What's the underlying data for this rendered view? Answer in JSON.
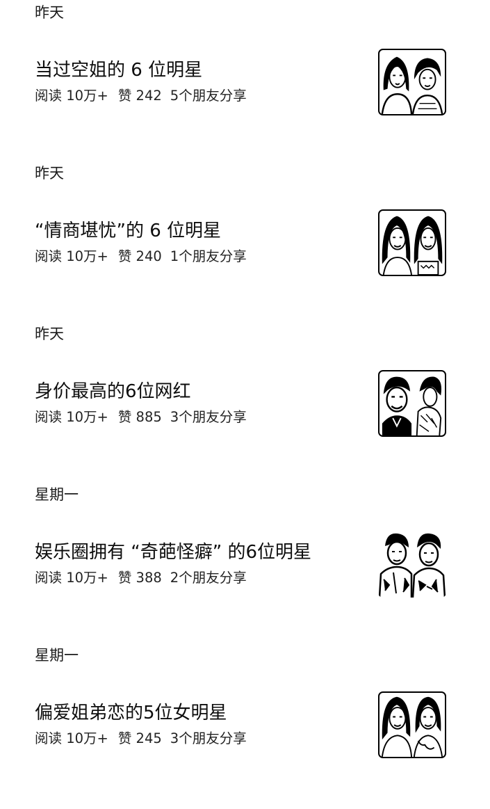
{
  "feed": [
    {
      "date": "昨天",
      "title": "当过空姐的 6 位明星",
      "reads": "阅读 10万+",
      "likes": "赞 242",
      "shares": "5个朋友分享",
      "thumbnail": "two-women-photo"
    },
    {
      "date": "昨天",
      "title": "“情商堪忧”的 6 位明星",
      "reads": "阅读 10万+",
      "likes": "赞 240",
      "shares": "1个朋友分享",
      "thumbnail": "two-women-photo"
    },
    {
      "date": "昨天",
      "title": "身价最高的6位网红",
      "reads": "阅读 10万+",
      "likes": "赞 885",
      "shares": "3个朋友分享",
      "thumbnail": "man-and-woman-photo"
    },
    {
      "date": "星期一",
      "title": "娱乐圈拥有 “奇葩怪癖” 的6位明星",
      "reads": "阅读 10万+",
      "likes": "赞 388",
      "shares": "2个朋友分享",
      "thumbnail": "two-men-photo"
    },
    {
      "date": "星期一",
      "title": "偏爱姐弟恋的5位女明星",
      "reads": "阅读 10万+",
      "likes": "赞 245",
      "shares": "3个朋友分享",
      "thumbnail": "two-women-photo"
    }
  ]
}
